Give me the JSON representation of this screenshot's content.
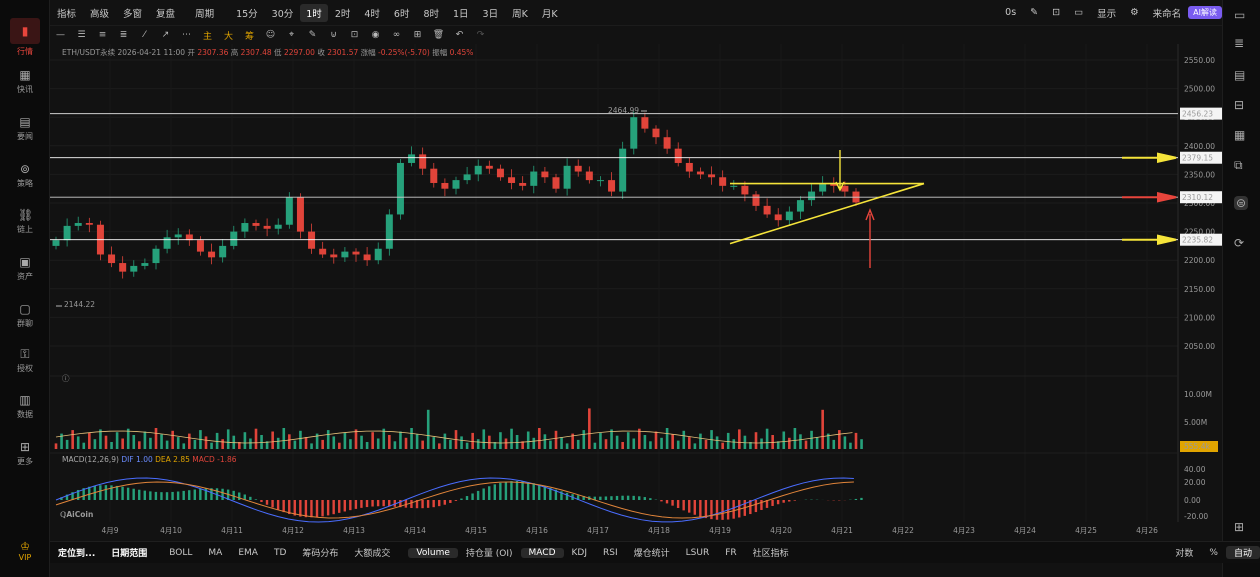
{
  "sidebar": {
    "items": [
      {
        "label": "行情",
        "icon": "chart-icon"
      },
      {
        "label": "快讯",
        "icon": "news-icon"
      },
      {
        "label": "要闻",
        "icon": "document-icon"
      },
      {
        "label": "策略",
        "icon": "robot-icon"
      },
      {
        "label": "链上",
        "icon": "chain-icon"
      },
      {
        "label": "资产",
        "icon": "wallet-icon"
      },
      {
        "label": "群聊",
        "icon": "chat-icon"
      },
      {
        "label": "授权",
        "icon": "key-icon"
      },
      {
        "label": "数据",
        "icon": "data-icon"
      },
      {
        "label": "更多",
        "icon": "grid-icon"
      }
    ],
    "vip": "VIP"
  },
  "topbar": {
    "items": [
      "指标",
      "高级",
      "多窗",
      "复盘",
      "周期",
      "15分",
      "30分",
      "1时",
      "2时",
      "4时",
      "6时",
      "8时",
      "1日",
      "3日",
      "周K",
      "月K"
    ],
    "selected": "1时",
    "right": [
      "0s",
      "显示",
      "来命名",
      "AI解读"
    ]
  },
  "info": {
    "symbol": "ETH/USDT永续",
    "time": "2026-04-21 11:00",
    "open_label": "开",
    "open": "2307.36",
    "high_label": "高",
    "high": "2307.48",
    "low_label": "低",
    "low": "2297.00",
    "close_label": "收",
    "close": "2301.57",
    "chg_label": "涨幅",
    "chg": "-0.25%(-5.70)",
    "amp_label": "振幅",
    "amp": "0.45%"
  },
  "price_axis": [
    "2550.00",
    "2500.00",
    "2450.00",
    "2400.00",
    "2350.00",
    "2300.00",
    "2250.00",
    "2200.00",
    "2150.00",
    "2100.00",
    "2050.00"
  ],
  "levels": [
    "2456.23",
    "2379.15",
    "2310.12",
    "2235.82"
  ],
  "annotations": {
    "high": "2464.99",
    "low": "2144.22"
  },
  "volume": {
    "ticks": [
      "10.00M",
      "5.00M"
    ],
    "last": "555.4k"
  },
  "macd": {
    "label": "MACD(12,26,9)",
    "dif": "DIF 1.00",
    "dea": "DEA 2.85",
    "macd": "MACD -1.86",
    "ticks": [
      "40.00",
      "20.00",
      "0.00",
      "-20.00"
    ]
  },
  "dates": [
    "4月9",
    "4月10",
    "4月11",
    "4月12",
    "4月13",
    "4月14",
    "4月15",
    "4月16",
    "4月17",
    "4月18",
    "4月19",
    "4月20",
    "4月21",
    "4月22",
    "4月23",
    "4月24",
    "4月25",
    "4月26"
  ],
  "logo": "AiCoin",
  "bottombar": {
    "items": [
      "定位到...",
      "日期范围",
      "BOLL",
      "MA",
      "EMA",
      "TD",
      "筹码分布",
      "大额成交",
      "Volume",
      "持仓量 (OI)",
      "MACD",
      "KDJ",
      "RSI",
      "爆仓统计",
      "LSUR",
      "FR",
      "社区指标"
    ],
    "right": [
      "对数",
      "%",
      "自动"
    ]
  },
  "colors": {
    "up": "#26a17b",
    "down": "#e0443a",
    "line": "#f5e43a",
    "red": "#e8453c"
  },
  "chart_data": {
    "type": "candlestick",
    "symbol": "ETH/USDT",
    "interval": "1h",
    "closes": [
      2235,
      2260,
      2265,
      2262,
      2210,
      2195,
      2180,
      2190,
      2195,
      2220,
      2240,
      2245,
      2235,
      2215,
      2205,
      2225,
      2250,
      2265,
      2260,
      2255,
      2262,
      2310,
      2250,
      2220,
      2210,
      2205,
      2215,
      2210,
      2200,
      2220,
      2280,
      2370,
      2385,
      2360,
      2335,
      2325,
      2340,
      2350,
      2365,
      2360,
      2345,
      2335,
      2330,
      2355,
      2345,
      2325,
      2365,
      2355,
      2340,
      2340,
      2320,
      2395,
      2450,
      2430,
      2415,
      2395,
      2370,
      2355,
      2350,
      2345,
      2330,
      2330,
      2315,
      2295,
      2280,
      2270,
      2285,
      2305,
      2320,
      2335,
      2330,
      2320,
      2301
    ],
    "highs_marked": 2464.99,
    "lows_marked": 2144.22
  }
}
